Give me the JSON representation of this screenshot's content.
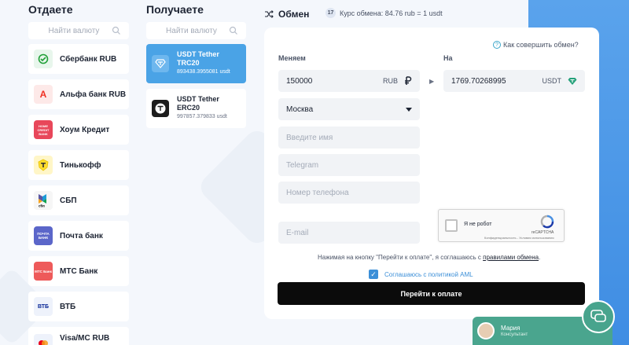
{
  "give": {
    "title": "Отдаете",
    "search_placeholder": "Найти валюту",
    "items": [
      {
        "label": "Сбербанк RUB",
        "icon": "sberbank-icon",
        "logo_text": "",
        "color": "#21a038"
      },
      {
        "label": "Альфа банк RUB",
        "icon": "alfa-bank-icon",
        "logo_text": "А",
        "color": "#ef3124"
      },
      {
        "label": "Хоум Кредит",
        "icon": "home-credit-icon",
        "logo_text": "HOME CREDIT BANK",
        "color": "#e8475a"
      },
      {
        "label": "Тинькофф",
        "icon": "tinkoff-icon",
        "logo_text": "",
        "color": "#ffdd2d"
      },
      {
        "label": "СБП",
        "icon": "sbp-icon",
        "logo_text": "сбп",
        "color": "#f6f6f6"
      },
      {
        "label": "Почта банк",
        "icon": "pochta-bank-icon",
        "logo_text": "ПОЧТА БАНК",
        "color": "#5b66c9"
      },
      {
        "label": "МТС Банк",
        "icon": "mts-bank-icon",
        "logo_text": "МТС Банк",
        "color": "#ee5a5a"
      },
      {
        "label": "ВТБ",
        "icon": "vtb-icon",
        "logo_text": "ВТБ",
        "color": "#f1f4fb"
      },
      {
        "label": "Visa/MC RUB",
        "icon": "visa-mc-icon",
        "logo_text": "",
        "color": "#f1f4fb"
      }
    ]
  },
  "receive": {
    "title": "Получаете",
    "search_placeholder": "Найти валюту",
    "items": [
      {
        "name": "USDT Tether TRC20",
        "amount": "893438.3955081 usdt",
        "icon": "tether-icon",
        "selected": true
      },
      {
        "name": "USDT Tether ERC20",
        "amount": "997857.379833 usdt",
        "icon": "tether-icon",
        "selected": false
      }
    ]
  },
  "exchange": {
    "title": "Обмен",
    "rate_badge": "17",
    "rate": "Курс обмена: 84.76 rub = 1 usdt",
    "howto": "Как совершить обмен?",
    "give_label": "Меняем",
    "receive_label": "На",
    "give_amount": "150000",
    "give_currency": "RUB",
    "receive_amount": "1769.70268995",
    "receive_currency": "USDT",
    "city": "Москва",
    "name_placeholder": "Введите имя",
    "telegram_placeholder": "Telegram",
    "phone_placeholder": "Номер телефона",
    "email_placeholder": "E-mail",
    "captcha_label": "Я не робот",
    "captcha_brand": "reCAPTCHA",
    "captcha_small": "Конфиденциальность - Условия использования",
    "agree_text": "Нажимая на кнопку \"Перейти к оплате\", я соглашаюсь с",
    "agree_link": "правилами обмена",
    "agree_end": ".",
    "aml_text": "Соглашаюсь с политикой AML",
    "submit": "Перейти к оплате"
  },
  "chat": {
    "name": "Мария",
    "role": "Консультант"
  },
  "colors": {
    "accent": "#3b8fd8",
    "selected_bg": "#4aa3e6",
    "chat_green": "#4aa58e"
  }
}
